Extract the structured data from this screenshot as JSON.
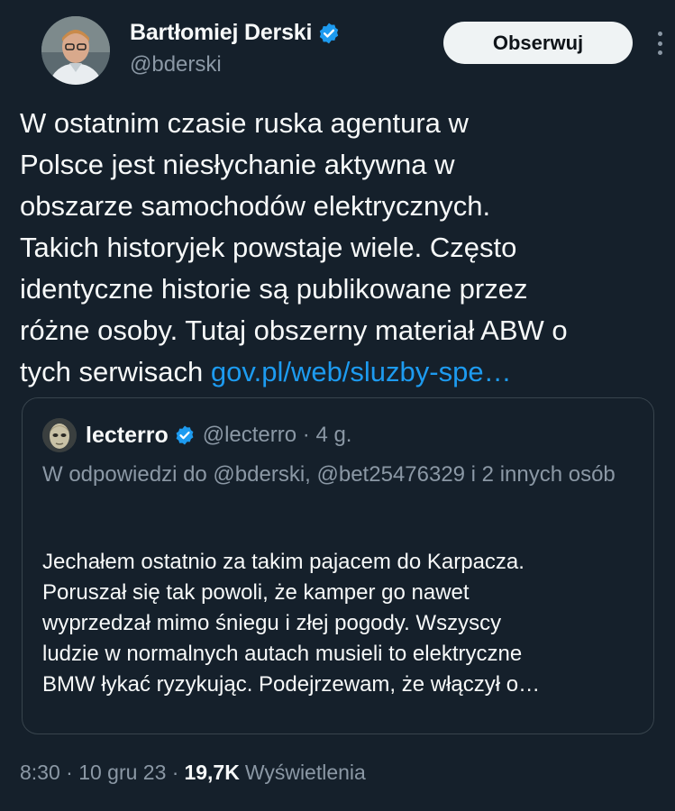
{
  "author": {
    "display_name": "Bartłomiej Derski",
    "handle": "@bderski",
    "verified_icon": "verified-badge-icon",
    "avatar_icon": "profile-photo"
  },
  "actions": {
    "follow_label": "Obserwuj",
    "more_icon": "more-options-icon"
  },
  "tweet": {
    "text": "W ostatnim czasie ruska agentura w\nPolsce jest niesłychanie aktywna w\nobszarze samochodów elektrycznych.\nTakich historyjek powstaje wiele. Często\nidentyczne historie są publikowane przez\nróżne osoby. Tutaj obszerny materiał ABW o\ntych serwisach ",
    "link_text": "gov.pl/web/sluzby-spe…"
  },
  "quoted": {
    "display_name": "lecterro",
    "handle_time": "@lecterro · 4 g.",
    "reply_to": "W odpowiedzi do @bderski, @bet25476329 i 2 innych osób",
    "text": "Jechałem ostatnio za takim pajacem do Karpacza.\nPoruszał się tak powoli, że kamper go nawet\nwyprzedzał mimo śniegu i  złej pogody. Wszyscy\nludzie w normalnych autach musieli to elektryczne\nBMW łykać ryzykując. Podejrzewam, że włączył o…"
  },
  "meta": {
    "timestamp": "8:30 · 10 gru 23 ·",
    "views_count": "19,7K",
    "views_label": "Wyświetlenia"
  },
  "colors": {
    "background": "#15202b",
    "link": "#1d9bf0",
    "secondary_text": "#8b98a5",
    "verified": "#1d9bf0"
  }
}
